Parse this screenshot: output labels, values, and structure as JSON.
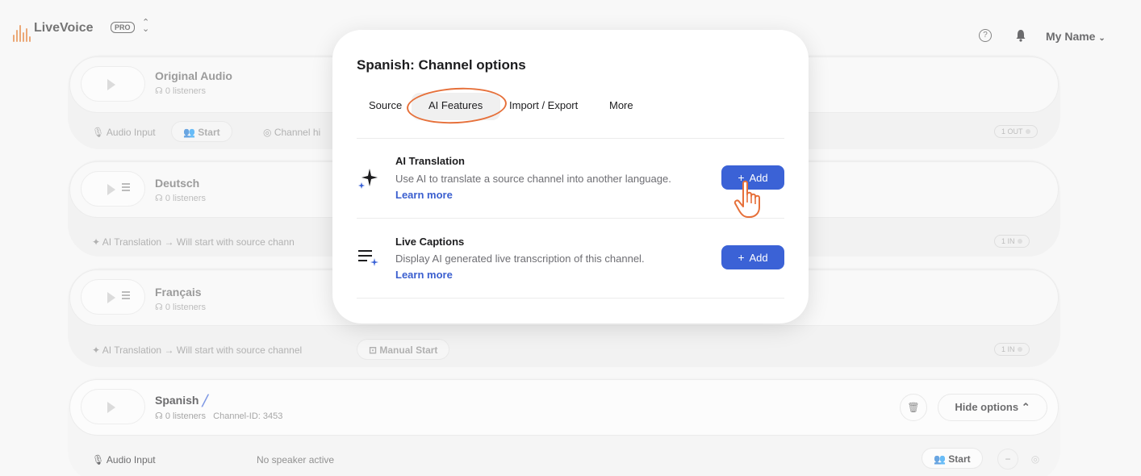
{
  "app": {
    "name": "LiveVoice",
    "badge": "PRO",
    "user": "My Name"
  },
  "channels": [
    {
      "name": "Original Audio",
      "listeners": "0 listeners",
      "row": {
        "input_label": "Audio Input",
        "start": "Start",
        "extra": "Channel hi",
        "badge": "1 OUT"
      }
    },
    {
      "name": "Deutsch",
      "listeners": "0 listeners",
      "row": {
        "text": "AI Translation → Will start with source chann",
        "badge": "1 IN"
      }
    },
    {
      "name": "Français",
      "listeners": "0 listeners",
      "row": {
        "text": "AI Translation → Will start with source channel",
        "button": "Manual Start",
        "badge": "1 IN"
      }
    },
    {
      "name": "Spanish",
      "listeners": "0 listeners",
      "channel_id": "Channel-ID: 3453",
      "hide_options": "Hide options",
      "row": {
        "input_label": "Audio Input",
        "status": "No speaker active",
        "start": "Start"
      }
    }
  ],
  "modal": {
    "title": "Spanish: Channel options",
    "tabs": [
      "Source",
      "AI Features",
      "Import / Export",
      "More"
    ],
    "active_tab": "AI Features",
    "features": [
      {
        "title": "AI Translation",
        "description": "Use AI to translate a source channel into another language.",
        "link": "Learn more",
        "button": "Add",
        "icon": "sparkle-icon"
      },
      {
        "title": "Live Captions",
        "description": "Display AI generated live transcription of this channel.",
        "link": "Learn more",
        "button": "Add",
        "icon": "captions-icon"
      }
    ]
  },
  "colors": {
    "accent": "#3b62d6",
    "highlight": "#e6703a",
    "brand": "#e07a2e"
  }
}
